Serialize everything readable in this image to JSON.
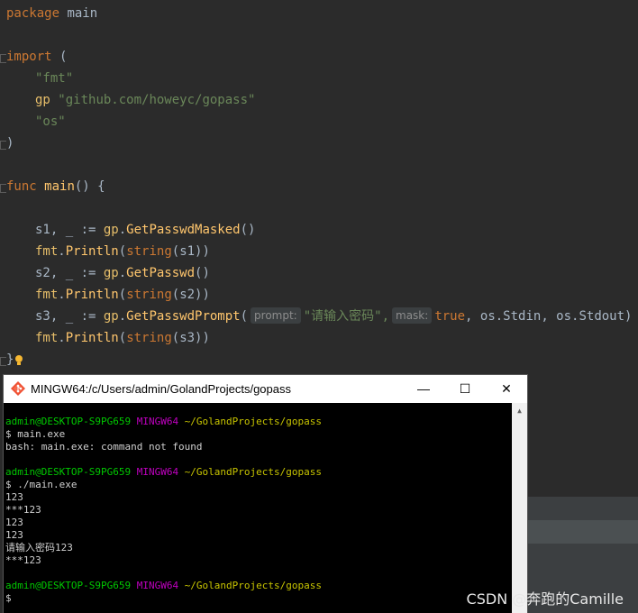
{
  "editor": {
    "line_package": {
      "kw": "package",
      "name": "main"
    },
    "line_import": {
      "kw": "import",
      "paren": "("
    },
    "imports": [
      {
        "alias": "",
        "path": "\"fmt\""
      },
      {
        "alias": "gp",
        "path": "\"github.com/howeyc/gopass\""
      },
      {
        "alias": "",
        "path": "\"os\""
      }
    ],
    "line_close_paren": ")",
    "line_func": {
      "kw": "func",
      "name": "main",
      "rest": "() {"
    },
    "statements": [
      {
        "lhs": "s1, _ := ",
        "pkg": "gp",
        "fn": "GetPasswdMasked",
        "args": "()"
      },
      {
        "pkg": "fmt",
        "fn": "Println",
        "open": "(",
        "builtin": "string",
        "inner": "(s1)",
        "close": ")"
      },
      {
        "lhs": "s2, _ := ",
        "pkg": "gp",
        "fn": "GetPasswd",
        "args": "()"
      },
      {
        "pkg": "fmt",
        "fn": "Println",
        "open": "(",
        "builtin": "string",
        "inner": "(s2)",
        "close": ")"
      },
      {
        "lhs": "s3, _ := ",
        "pkg": "gp",
        "fn": "GetPasswdPrompt",
        "open": "(",
        "hint_prompt": "prompt:",
        "arg1": "\"请输入密码\",",
        "hint_mask": "mask:",
        "arg2": "true",
        "rest": ", os.Stdin, os.Stdout)"
      },
      {
        "pkg": "fmt",
        "fn": "Println",
        "open": "(",
        "builtin": "string",
        "inner": "(s3)",
        "close": ")"
      }
    ],
    "line_close_brace": "}"
  },
  "terminal": {
    "title": "MINGW64:/c/Users/admin/GolandProjects/gopass",
    "buttons": {
      "minimize": "—",
      "maximize": "☐",
      "close": "✕"
    },
    "prompt": {
      "user": "admin@DESKTOP-S9PG659",
      "shell": "MINGW64",
      "path": "~/GolandProjects/gopass"
    },
    "lines": [
      "$ main.exe",
      "bash: main.exe: command not found",
      "$ ./main.exe",
      "123",
      "***123",
      "123",
      "123",
      "请输入密码123",
      "***123",
      "$"
    ]
  },
  "watermark": "CSDN @奔跑的Camille",
  "colors": {
    "editor_bg": "#2b2b2b",
    "keyword": "#cc7832",
    "string": "#6a8759",
    "terminal_bg": "#000000"
  }
}
